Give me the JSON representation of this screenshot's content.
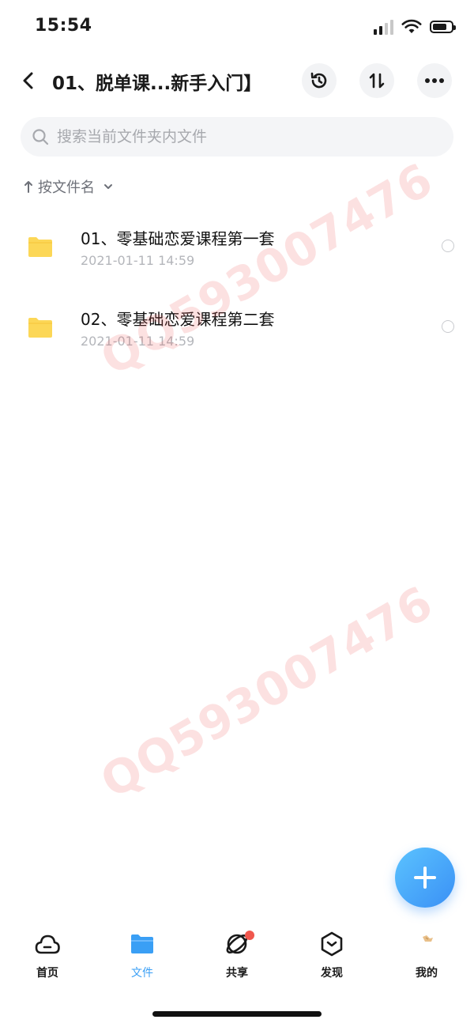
{
  "status_bar": {
    "time": "15:54"
  },
  "header": {
    "title": "01、脱单课...新手入门】",
    "icons": {
      "back": "chevron-left-icon",
      "history": "history-icon",
      "sort": "sort-icon",
      "more": "more-icon"
    }
  },
  "search": {
    "placeholder": "搜索当前文件夹内文件"
  },
  "sort": {
    "label": "按文件名"
  },
  "files": [
    {
      "name": "01、零基础恋爱课程第一套",
      "date": "2021-01-11 14:59"
    },
    {
      "name": "02、零基础恋爱课程第二套",
      "date": "2021-01-11 14:59"
    }
  ],
  "watermark": {
    "text": "QQ593007476"
  },
  "tabbar": {
    "items": [
      {
        "label": "首页",
        "icon": "cloud-home-icon"
      },
      {
        "label": "文件",
        "icon": "folder-icon",
        "active": true
      },
      {
        "label": "共享",
        "icon": "orbit-icon",
        "badge": true
      },
      {
        "label": "发现",
        "icon": "discover-icon"
      },
      {
        "label": "我的",
        "icon": "avatar-icon"
      }
    ]
  },
  "colors": {
    "accent": "#3a9ff5",
    "folder": "#fcd757",
    "badge": "#f0574d"
  }
}
